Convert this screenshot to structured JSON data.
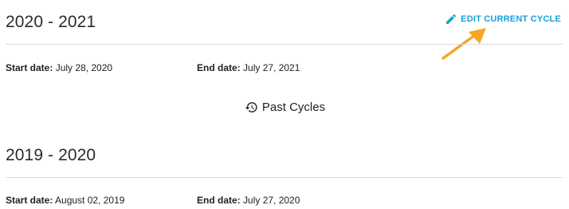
{
  "current_cycle": {
    "title": "2020 - 2021",
    "start_label": "Start date:",
    "start_value": "July 28, 2020",
    "end_label": "End date:",
    "end_value": "July 27, 2021",
    "edit_label": "EDIT CURRENT CYCLE",
    "edit_icon": "pencil-icon"
  },
  "past_cycles": {
    "label": "Past Cycles",
    "icon": "history-icon"
  },
  "previous_cycle": {
    "title": "2019 - 2020",
    "start_label": "Start date:",
    "start_value": "August 02, 2019",
    "end_label": "End date:",
    "end_value": "July 27, 2020"
  },
  "colors": {
    "accent": "#1a9fd6",
    "annotation": "#f5a623",
    "divider": "#dcdcdc"
  }
}
